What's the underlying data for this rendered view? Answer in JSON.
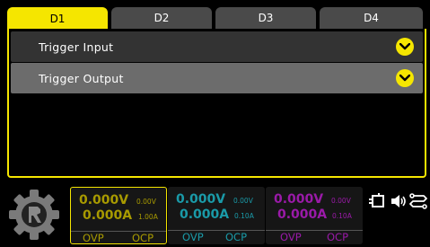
{
  "tabs": [
    {
      "label": "D1",
      "active": true
    },
    {
      "label": "D2",
      "active": false
    },
    {
      "label": "D3",
      "active": false
    },
    {
      "label": "D4",
      "active": false
    }
  ],
  "panel": {
    "rows": [
      {
        "label": "Trigger Input",
        "icon": "chevron-down-icon"
      },
      {
        "label": "Trigger Output",
        "icon": "chevron-down-icon"
      }
    ]
  },
  "channels": [
    {
      "voltage": "0.000V",
      "current": "0.000A",
      "set_voltage": "0.00V",
      "set_current": "1.00A",
      "ovp": "OVP",
      "ocp": "OCP",
      "color": "#a89a00",
      "active": true
    },
    {
      "voltage": "0.000V",
      "current": "0.000A",
      "set_voltage": "0.00V",
      "set_current": "0.10A",
      "ovp": "OVP",
      "ocp": "OCP",
      "color": "#1a9aa8",
      "active": false
    },
    {
      "voltage": "0.000V",
      "current": "0.000A",
      "set_voltage": "0.00V",
      "set_current": "0.10A",
      "ovp": "OVP",
      "ocp": "OCP",
      "color": "#9a1aa8",
      "active": false
    }
  ],
  "status_icons": [
    "remote-io-icon",
    "speaker-icon",
    "usb-connection-icon"
  ],
  "colors": {
    "accent": "#f5e600",
    "tab_inactive": "#4a4a4a",
    "row_expanded": "#6c6c6c"
  }
}
